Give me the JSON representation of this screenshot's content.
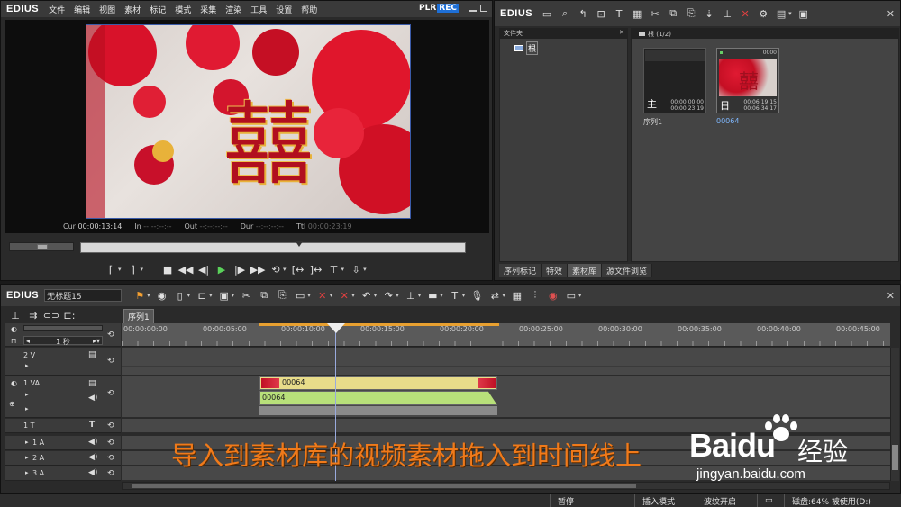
{
  "app": {
    "logo": "EDIUS"
  },
  "menu": [
    "文件",
    "编辑",
    "视图",
    "素材",
    "标记",
    "模式",
    "采集",
    "渲染",
    "工具",
    "设置",
    "帮助"
  ],
  "player": {
    "mode_plr": "PLR",
    "mode_rec": "REC",
    "timecodes": [
      {
        "label": "Cur",
        "value": "00:00:13:14"
      },
      {
        "label": "In",
        "value": "--:--:--:--"
      },
      {
        "label": "Out",
        "value": "--:--:--:--"
      },
      {
        "label": "Dur",
        "value": "--:--:--:--"
      },
      {
        "label": "Ttl",
        "value": "00:00:23:19"
      }
    ],
    "preview_text": "囍"
  },
  "bin": {
    "logo": "EDIUS",
    "folder_panel_title": "文件夹",
    "root_label": "根",
    "clip_panel_title": "根 (1/2)",
    "clips": [
      {
        "name": "序列1",
        "tc_in": "00:00:00:00",
        "tc_dur": "00:00:23:19",
        "type_glyph": "主",
        "selected": false,
        "header": ""
      },
      {
        "name": "00064",
        "tc_in": "00:06:19:15",
        "tc_dur": "00:06:34:17",
        "type_glyph": "日",
        "selected": true,
        "header": "0000"
      }
    ],
    "tabs": [
      "序列标记",
      "特效",
      "素材库",
      "源文件浏览"
    ],
    "active_tab": 2
  },
  "timeline": {
    "logo": "EDIUS",
    "project_name": "无标题15",
    "sequence_tab": "序列1",
    "zoom_label": "1 秒",
    "ruler": [
      "00:00:00:00",
      "00:00:05:00",
      "00:00:10:00",
      "00:00:15:00",
      "00:00:20:00",
      "00:00:25:00",
      "00:00:30:00",
      "00:00:35:00",
      "00:00:40:00",
      "00:00:45:00"
    ],
    "tracks": [
      {
        "name": "2 V"
      },
      {
        "name": "1 VA"
      },
      {
        "name": "1 T"
      },
      {
        "name": "1 A"
      },
      {
        "name": "2 A"
      },
      {
        "name": "3 A"
      }
    ],
    "clip_video_label": "00064",
    "clip_audio_label": "00064"
  },
  "caption": "导入到素材库的视频素材拖入到时间线上",
  "watermark": {
    "brand": "Baidu",
    "brand_cn": "经验",
    "url": "jingyan.baidu.com"
  },
  "status": {
    "pause": "暂停",
    "insert_mode": "插入模式",
    "ripple": "波纹开启",
    "disk": "磁盘:64% 被使用(D:)"
  },
  "colors": {
    "rec_badge": "#1e6fd6",
    "clip_video": "#e8dc8a",
    "clip_audio": "#b8e07a",
    "caption": "#f07a1a"
  }
}
